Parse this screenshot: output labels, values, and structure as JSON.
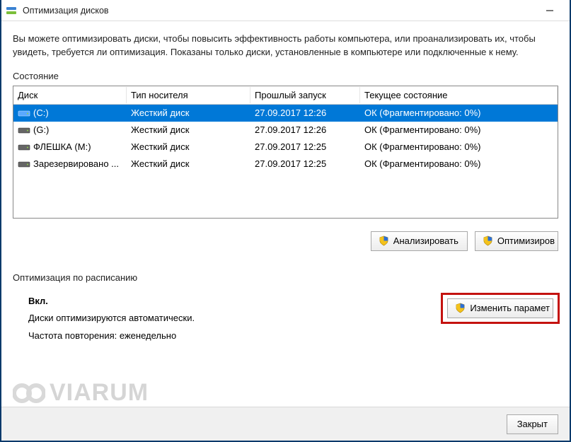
{
  "window": {
    "title": "Оптимизация дисков"
  },
  "description": "Вы можете оптимизировать диски, чтобы повысить эффективность работы  компьютера, или проанализировать их, чтобы увидеть, требуется ли оптимизация. Показаны только диски, установленные в компьютере или подключенные к нему.",
  "status_label": "Состояние",
  "columns": {
    "disk": "Диск",
    "media": "Тип носителя",
    "last": "Прошлый запуск",
    "state": "Текущее состояние"
  },
  "rows": [
    {
      "disk": "(C:)",
      "media": "Жесткий диск",
      "last": "27.09.2017 12:26",
      "state": "ОК (Фрагментировано: 0%)",
      "selected": true,
      "icon_color": "#2f74c7"
    },
    {
      "disk": "(G:)",
      "media": "Жесткий диск",
      "last": "27.09.2017 12:26",
      "state": "ОК (Фрагментировано: 0%)",
      "selected": false,
      "icon_color": "#666"
    },
    {
      "disk": "ФЛЕШКА (M:)",
      "media": "Жесткий диск",
      "last": "27.09.2017 12:25",
      "state": "ОК (Фрагментировано: 0%)",
      "selected": false,
      "icon_color": "#666"
    },
    {
      "disk": "Зарезервировано ...",
      "media": "Жесткий диск",
      "last": "27.09.2017 12:25",
      "state": "ОК (Фрагментировано: 0%)",
      "selected": false,
      "icon_color": "#666"
    }
  ],
  "buttons": {
    "analyze": "Анализировать",
    "optimize": "Оптимизиров",
    "change_settings": "Изменить парамет",
    "close": "Закрыт"
  },
  "schedule": {
    "header": "Оптимизация по расписанию",
    "on": "Вкл.",
    "auto": "Диски оптимизируются автоматически.",
    "freq": "Частота повторения: еженедельно"
  },
  "watermark": "VIARUM"
}
